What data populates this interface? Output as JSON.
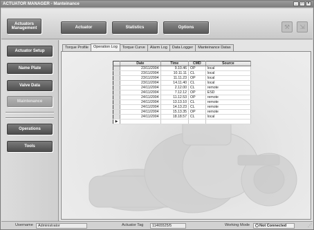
{
  "window": {
    "title": "ACTUATOR MANAGER - Manteinance",
    "minimize_glyph": "_",
    "maximize_glyph": "□",
    "close_glyph": "×"
  },
  "toolbar": {
    "actuators_management": "Actuators Management",
    "actuator": "Actuator",
    "statistics": "Statistics",
    "options": "Options",
    "icons": [
      "tool-icon",
      "exit-icon"
    ]
  },
  "nav": {
    "actuator_setup": "Actuator Setup",
    "name_plate": "Name Plate",
    "valve_data": "Valve Data",
    "maintenance": "Maintenance",
    "operations": "Operations",
    "tools": "Tools"
  },
  "tabs": [
    {
      "label": "Torque Profile",
      "active": false
    },
    {
      "label": "Operation Log",
      "active": true
    },
    {
      "label": "Torque Curve",
      "active": false
    },
    {
      "label": "Alarm Log",
      "active": false
    },
    {
      "label": "Data Logger",
      "active": false
    },
    {
      "label": "Manteinance Datas",
      "active": false
    }
  ],
  "grid": {
    "columns": [
      "Date",
      "Time",
      "CMD",
      "Source"
    ],
    "rows": [
      [
        "23/11/2004",
        "9.10.46",
        "OP",
        "local"
      ],
      [
        "23/11/2004",
        "10.11.11",
        "CL",
        "local"
      ],
      [
        "23/11/2004",
        "11.11.23",
        "OP",
        "local"
      ],
      [
        "23/11/2004",
        "14.11.40",
        "CL",
        "local"
      ],
      [
        "24/11/2004",
        "2.12.00",
        "CL",
        "remote"
      ],
      [
        "24/11/2004",
        "7.12.12",
        "OP",
        "ESD"
      ],
      [
        "24/11/2004",
        "11.12.53",
        "OP",
        "remote"
      ],
      [
        "24/11/2004",
        "13.13.10",
        "CL",
        "remote"
      ],
      [
        "24/11/2004",
        "14.13.23",
        "CL",
        "remote"
      ],
      [
        "24/11/2004",
        "15.13.35",
        "OP",
        "remote"
      ],
      [
        "24/11/2004",
        "18.18.57",
        "CL",
        "local"
      ]
    ],
    "new_row_marker": "▶"
  },
  "status": {
    "username_label": "Username",
    "username_value": "Administrator",
    "actuator_tag_label": "Actuator Tag",
    "actuator_tag_value": "11465525/5",
    "working_mode_label": "Working Mode",
    "connection": "Not Connected",
    "grip_glyph": "⋰"
  }
}
